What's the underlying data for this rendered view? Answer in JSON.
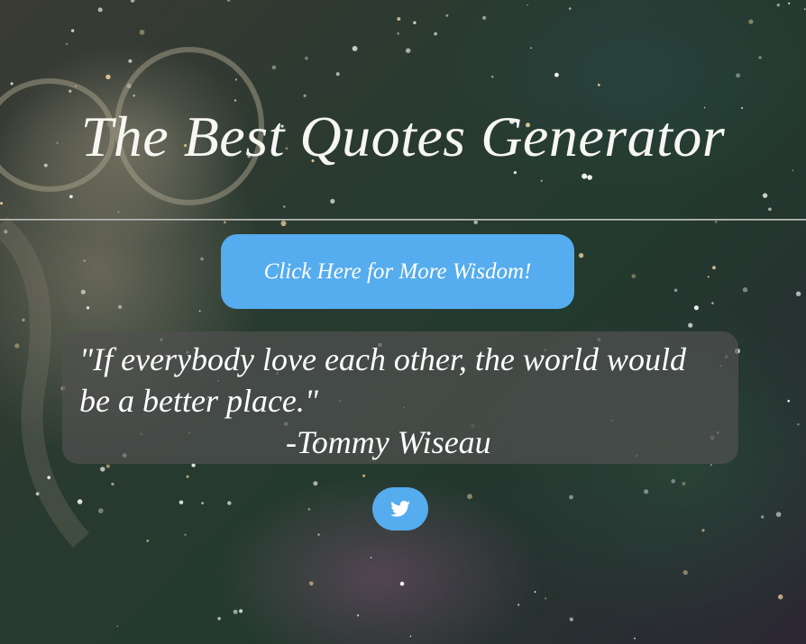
{
  "header": {
    "title": "The Best Quotes Generator"
  },
  "actions": {
    "new_quote_label": "Click Here for More Wisdom!",
    "tweet_icon": "twitter-bird-icon"
  },
  "quote": {
    "text": "\"If everybody love each other, the world would be a better place.\"",
    "author": "-Tommy Wiseau"
  },
  "colors": {
    "accent": "#55acee",
    "quote_box": "rgba(80,80,80,0.72)",
    "text": "#ffffff"
  }
}
